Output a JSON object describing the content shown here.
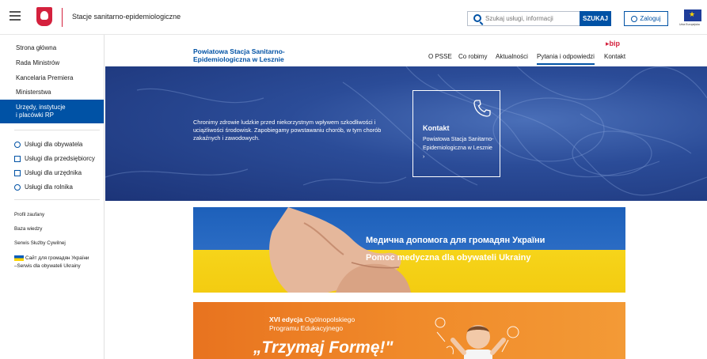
{
  "header": {
    "site_name": "Stacje sanitarno-epidemiologiczne",
    "search_placeholder": "Szukaj usługi, informacji",
    "search_button": "SZUKAJ",
    "login_button": "Zaloguj",
    "eu_label": "Unia Europejska"
  },
  "sidebar": {
    "main_items": [
      {
        "label": "Strona główna"
      },
      {
        "label": "Rada Ministrów"
      },
      {
        "label": "Kancelaria Premiera"
      },
      {
        "label": "Ministerstwa"
      },
      {
        "label_line1": "Urzędy, instytucje",
        "label_line2": "i placówki RP",
        "active": true
      }
    ],
    "services": [
      {
        "label": "Usługi dla obywatela",
        "icon": "person-icon"
      },
      {
        "label": "Usługi dla przedsiębiorcy",
        "icon": "briefcase-icon"
      },
      {
        "label": "Usługi dla urzędnika",
        "icon": "monitor-icon"
      },
      {
        "label": "Usługi dla rolnika",
        "icon": "person-icon"
      }
    ],
    "links": [
      {
        "label": "Profil zaufany"
      },
      {
        "label": "Baza wiedzy"
      },
      {
        "label": "Serwis Służby Cywilnej"
      },
      {
        "label_line1": "Сайт для громадян України",
        "label_line2": "–Serwis dla obywateli Ukrainy"
      }
    ]
  },
  "org": {
    "name_line1": "Powiatowa Stacja Sanitarno-",
    "name_line2": "Epidemiologiczna w Lesznie",
    "bip": "bip",
    "menu": [
      {
        "label": "O PSSE"
      },
      {
        "label": "Co robimy"
      },
      {
        "label": "Aktualności"
      },
      {
        "label": "Pytania i odpowiedzi",
        "active": true
      },
      {
        "label": "Kontakt"
      }
    ]
  },
  "hero": {
    "text": "Chronimy zdrowie ludzkie przed niekorzystnym wpływem szkodliwości i uciążliwości środowisk. Zapobiegamy powstawaniu chorób, w tym chorób zakaźnych i zawodowych.",
    "contact_title": "Kontakt",
    "contact_desc": "Powiatowa Stacja Sanitarno-Epidemiologiczna w Lesznie"
  },
  "banners": {
    "ukraine_title": "Медична допомога для громадян України",
    "ukraine_subtitle": "Pomoc medyczna dla obywateli Ukrainy",
    "edu_bold": "XVI edycja",
    "edu_line1": "Ogólnopolskiego",
    "edu_line2": "Programu Edukacyjnego",
    "edu_title": "„Trzymaj Formę!\""
  },
  "colors": {
    "primary": "#0052a5",
    "accent_red": "#d4213d"
  }
}
